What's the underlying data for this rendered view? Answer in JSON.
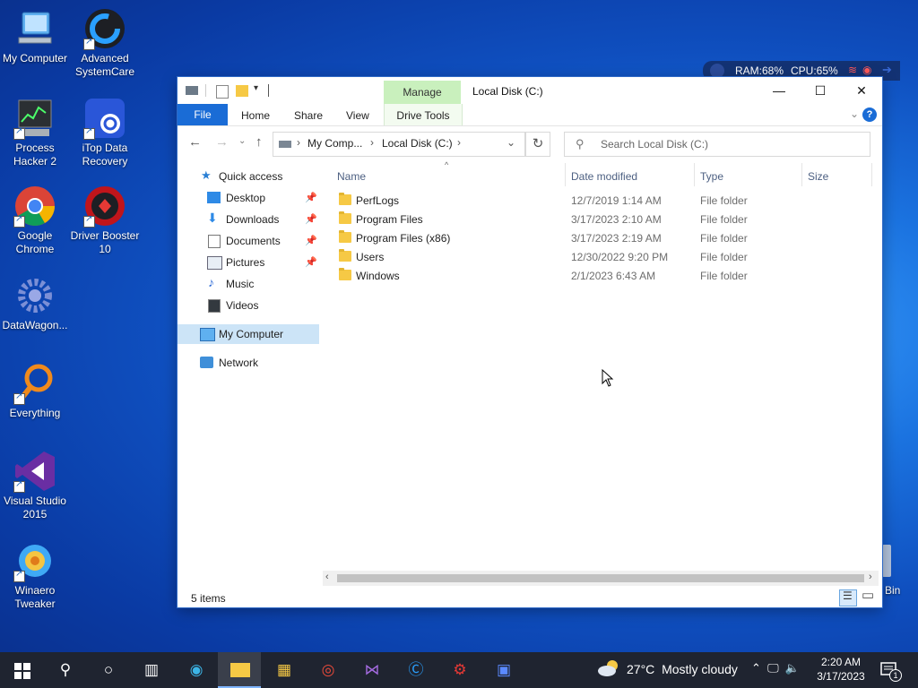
{
  "desktop": {
    "icons": [
      {
        "label": "My Computer"
      },
      {
        "label": "Advanced SystemCare"
      },
      {
        "label": "Process Hacker 2"
      },
      {
        "label": "iTop Data Recovery"
      },
      {
        "label": "Google Chrome"
      },
      {
        "label": "Driver Booster 10"
      },
      {
        "label": "DataWagon..."
      },
      {
        "label": "Everything"
      },
      {
        "label": "Visual Studio 2015"
      },
      {
        "label": "Winaero Tweaker"
      }
    ],
    "recycle_bin_label": "Bin"
  },
  "sysmon": {
    "ram": "RAM:68%",
    "cpu": "CPU:65%"
  },
  "window": {
    "title": "Local Disk (C:)",
    "contextual_tab": "Manage",
    "ribbon_tabs": [
      "File",
      "Home",
      "Share",
      "View"
    ],
    "contextual_group": "Drive Tools",
    "help": "?",
    "breadcrumb": [
      "My Comp...",
      "Local Disk (C:)"
    ],
    "search_placeholder": "Search Local Disk (C:)",
    "nav_pane": {
      "quick_access": "Quick access",
      "items": [
        "Desktop",
        "Downloads",
        "Documents",
        "Pictures",
        "Music",
        "Videos"
      ],
      "my_computer": "My Computer",
      "network": "Network"
    },
    "columns": [
      "Name",
      "Date modified",
      "Type",
      "Size"
    ],
    "rows": [
      {
        "name": "PerfLogs",
        "date": "12/7/2019 1:14 AM",
        "type": "File folder"
      },
      {
        "name": "Program Files",
        "date": "3/17/2023 2:10 AM",
        "type": "File folder"
      },
      {
        "name": "Program Files (x86)",
        "date": "3/17/2023 2:19 AM",
        "type": "File folder"
      },
      {
        "name": "Users",
        "date": "12/30/2022 9:20 PM",
        "type": "File folder"
      },
      {
        "name": "Windows",
        "date": "2/1/2023 6:43 AM",
        "type": "File folder"
      }
    ],
    "status": "5 items"
  },
  "taskbar": {
    "weather_temp": "27°C",
    "weather_desc": "Mostly cloudy",
    "time": "2:20 AM",
    "date": "3/17/2023",
    "notification_count": "1"
  },
  "colors": {
    "accent": "#1a6cd6",
    "manage_tab": "#c9f0bd",
    "folder": "#f6c945",
    "selection": "#cce4f7"
  }
}
